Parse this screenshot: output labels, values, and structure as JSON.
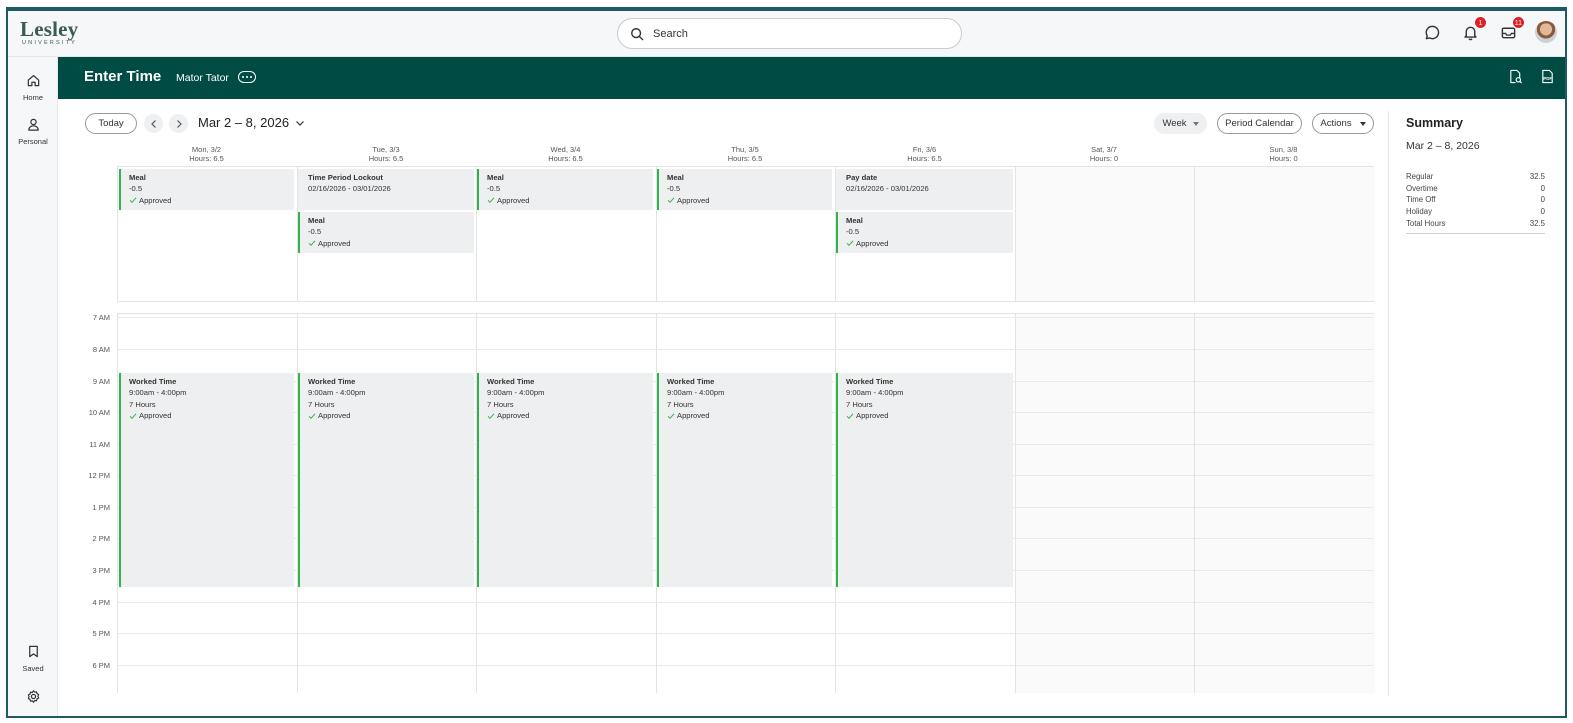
{
  "topbar": {
    "logo_main": "Lesley",
    "logo_sub": "UNIVERSITY",
    "search_placeholder": "Search",
    "notifications_count": "1",
    "inbox_count": "11"
  },
  "nav": {
    "home": "Home",
    "personal": "Personal",
    "saved": "Saved"
  },
  "header": {
    "title": "Enter Time",
    "person": "Mator Tator"
  },
  "toolbar": {
    "today": "Today",
    "date_range": "Mar 2 – 8, 2026",
    "week": "Week",
    "period_calendar": "Period Calendar",
    "actions": "Actions"
  },
  "days": [
    {
      "label": "Mon, 3/2",
      "hours": "Hours: 6.5"
    },
    {
      "label": "Tue, 3/3",
      "hours": "Hours: 6.5"
    },
    {
      "label": "Wed, 3/4",
      "hours": "Hours: 6.5"
    },
    {
      "label": "Thu, 3/5",
      "hours": "Hours: 6.5"
    },
    {
      "label": "Fri, 3/6",
      "hours": "Hours: 6.5"
    },
    {
      "label": "Sat, 3/7",
      "hours": "Hours: 0"
    },
    {
      "label": "Sun, 3/8",
      "hours": "Hours: 0"
    }
  ],
  "hours": [
    "7 AM",
    "8 AM",
    "9 AM",
    "10 AM",
    "11 AM",
    "12 PM",
    "1 PM",
    "2 PM",
    "3 PM",
    "4 PM",
    "5 PM",
    "6 PM"
  ],
  "allday_events": {
    "meal": {
      "title": "Meal",
      "value": "-0.5",
      "status": "Approved"
    },
    "lockout": {
      "title": "Time Period Lockout",
      "dates": "02/16/2026 - 03/01/2026"
    },
    "paydate": {
      "title": "Pay date",
      "dates": "02/16/2026 - 03/01/2026"
    }
  },
  "worked": {
    "title": "Worked Time",
    "time": "9:00am - 4:00pm",
    "hours": "7 Hours",
    "status": "Approved"
  },
  "summary": {
    "title": "Summary",
    "range": "Mar 2 – 8, 2026",
    "rows": [
      {
        "label": "Regular",
        "value": "32.5"
      },
      {
        "label": "Overtime",
        "value": "0"
      },
      {
        "label": "Time Off",
        "value": "0"
      },
      {
        "label": "Holiday",
        "value": "0"
      },
      {
        "label": "Total Hours",
        "value": "32.5"
      }
    ]
  },
  "colors": {
    "header_bg": "#004b44",
    "approved_bar": "#2fb34a",
    "badge": "#de1f26"
  }
}
